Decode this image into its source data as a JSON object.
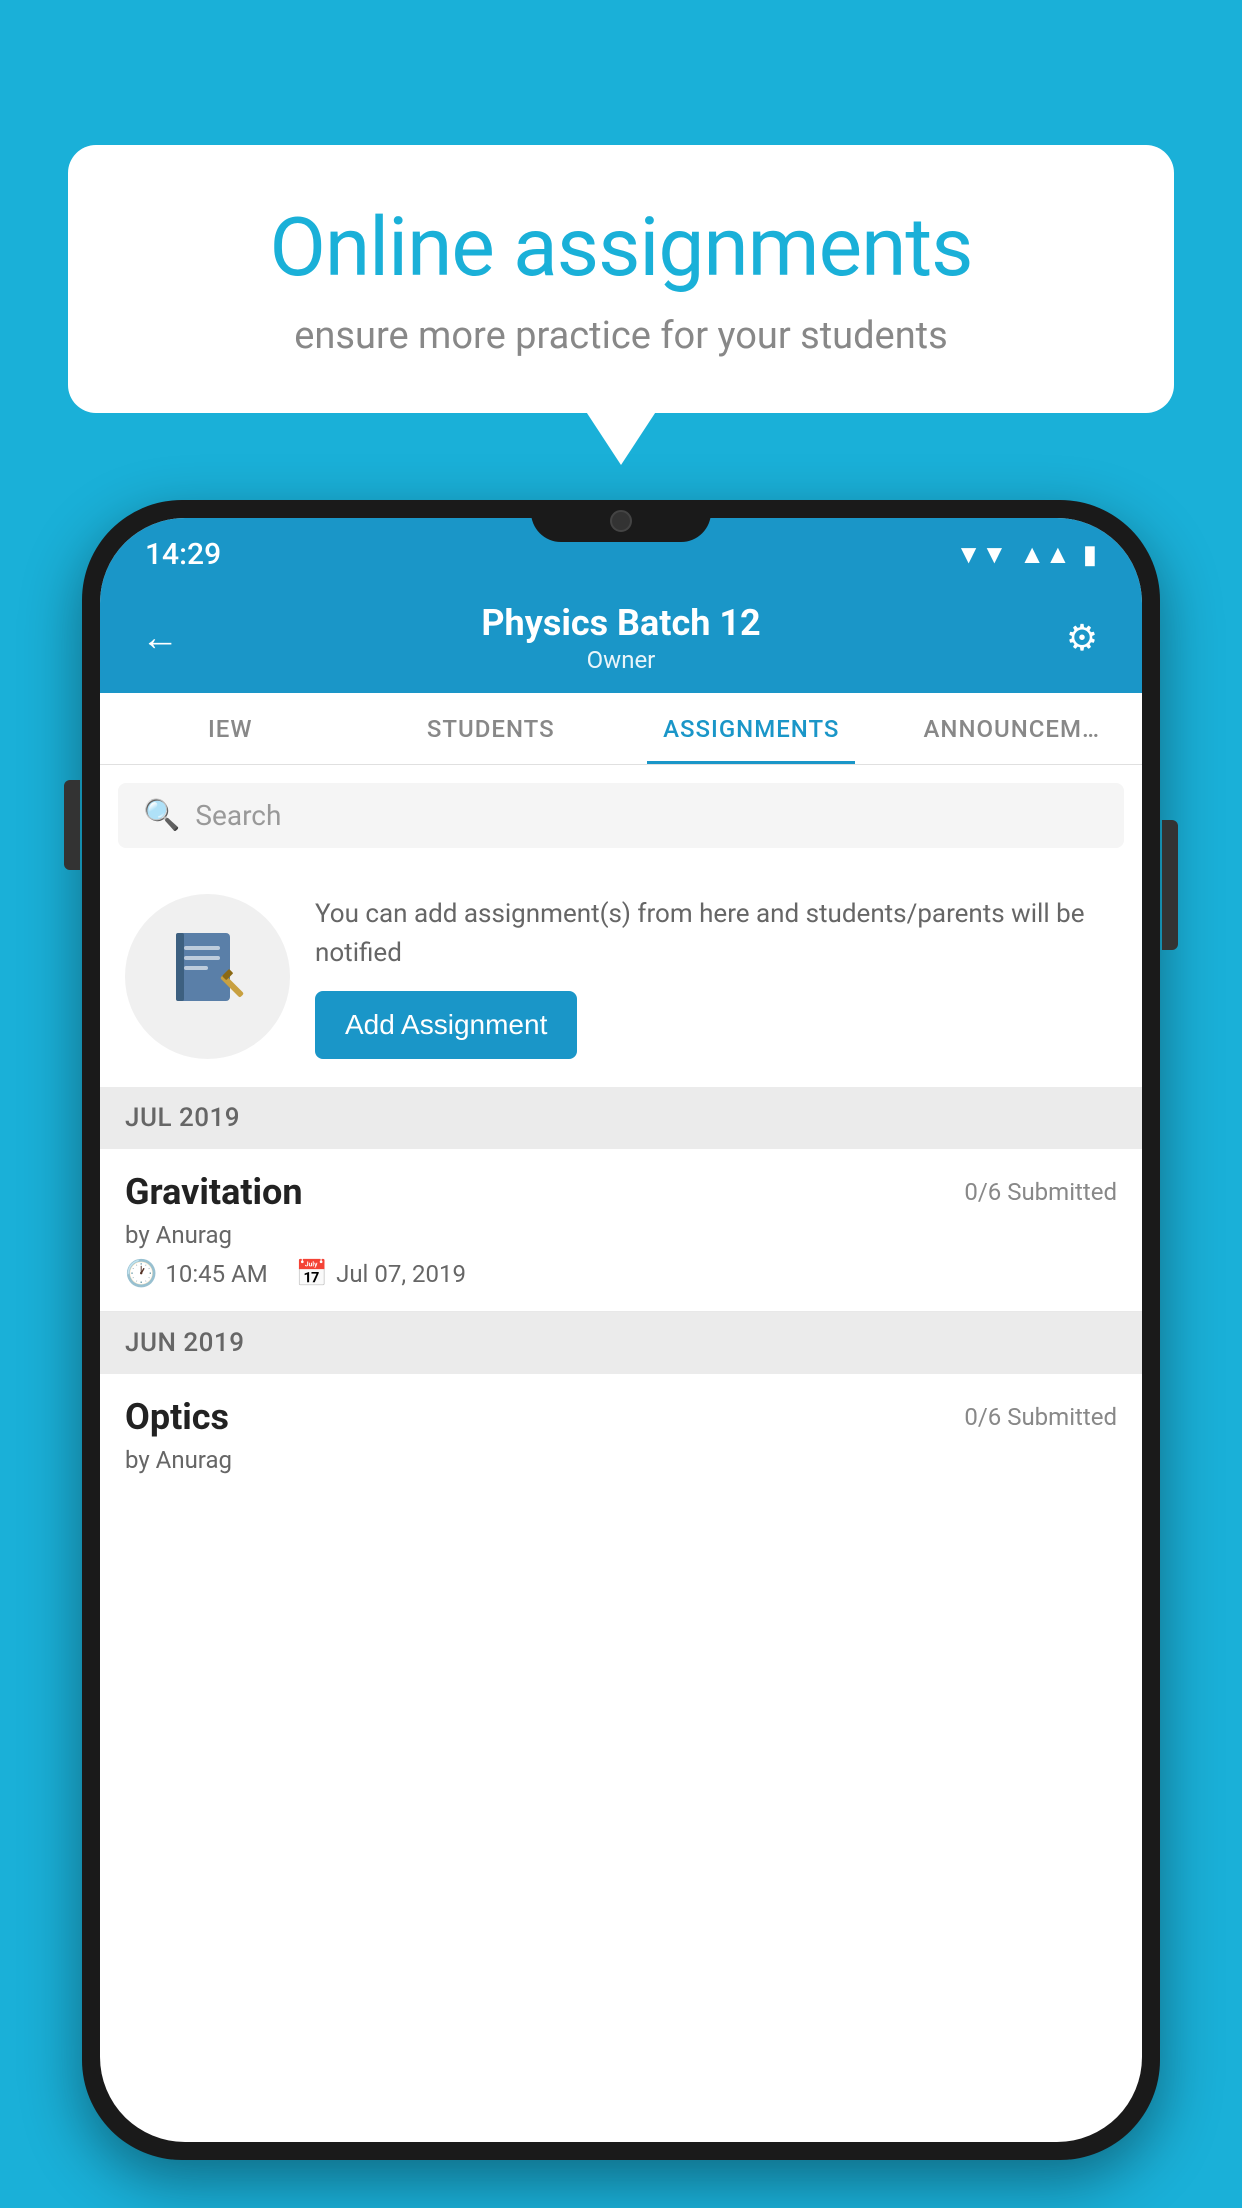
{
  "background_color": "#1ab0d8",
  "speech_bubble": {
    "title": "Online assignments",
    "subtitle": "ensure more practice for your students"
  },
  "status_bar": {
    "time": "14:29",
    "wifi_icon": "▼",
    "signal_icon": "◀",
    "battery_icon": "▮"
  },
  "header": {
    "back_icon": "←",
    "title": "Physics Batch 12",
    "subtitle": "Owner",
    "settings_icon": "⚙"
  },
  "tabs": [
    {
      "label": "IEW",
      "active": false
    },
    {
      "label": "STUDENTS",
      "active": false
    },
    {
      "label": "ASSIGNMENTS",
      "active": true
    },
    {
      "label": "ANNOUNCEM…",
      "active": false
    }
  ],
  "search": {
    "placeholder": "Search",
    "icon": "🔍"
  },
  "promo": {
    "icon": "📓",
    "description": "You can add assignment(s) from here and students/parents will be notified",
    "button_label": "Add Assignment"
  },
  "sections": [
    {
      "month_label": "JUL 2019",
      "assignments": [
        {
          "name": "Gravitation",
          "submitted": "0/6 Submitted",
          "by": "by Anurag",
          "time": "10:45 AM",
          "date": "Jul 07, 2019"
        }
      ]
    },
    {
      "month_label": "JUN 2019",
      "assignments": [
        {
          "name": "Optics",
          "submitted": "0/6 Submitted",
          "by": "by Anurag",
          "time": "",
          "date": ""
        }
      ]
    }
  ]
}
